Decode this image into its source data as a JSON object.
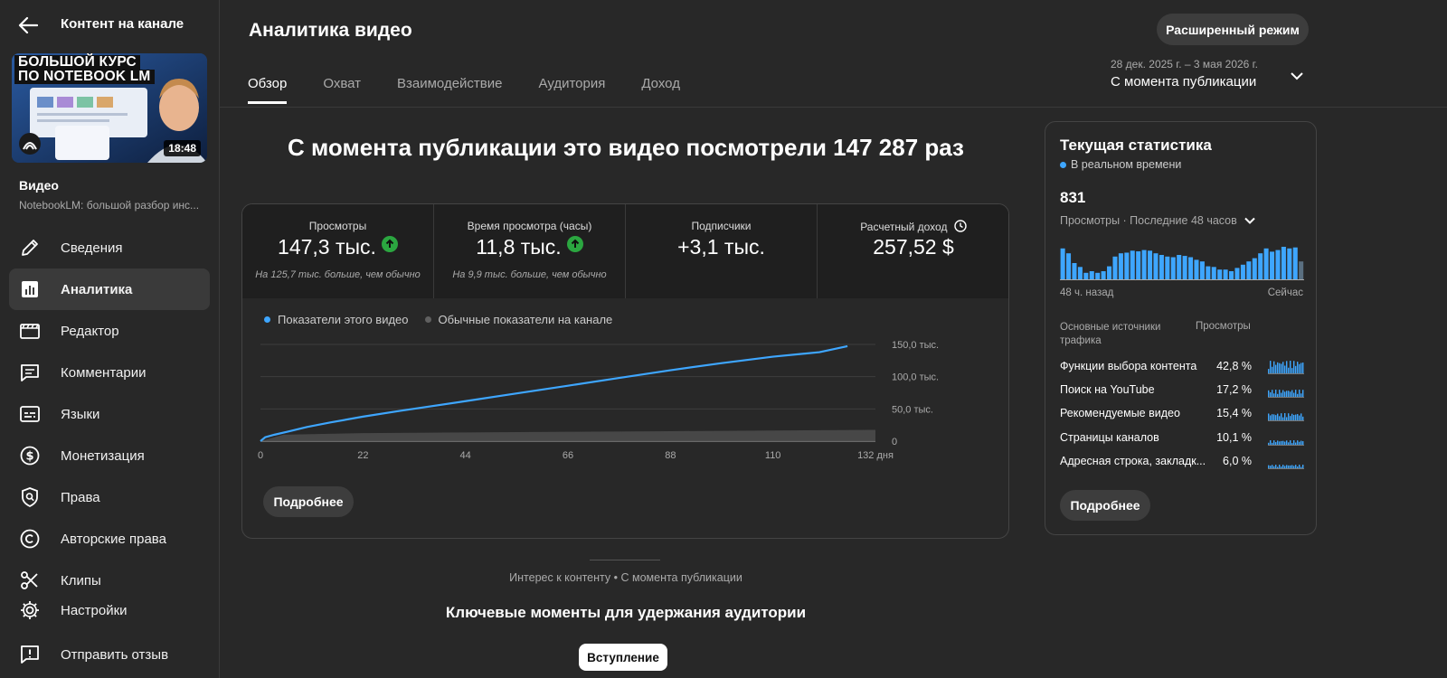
{
  "sidebar": {
    "title": "Контент на канале",
    "thumbnail": {
      "title_line1": "БОЛЬШОЙ КУРС",
      "title_line2": "ПО NOTEBOOK LM",
      "duration": "18:48"
    },
    "video_label": "Видео",
    "video_subtitle": "NotebookLM: большой разбор инс...",
    "items": [
      {
        "label": "Сведения",
        "icon": "pencil-icon"
      },
      {
        "label": "Аналитика",
        "icon": "analytics-icon",
        "active": true
      },
      {
        "label": "Редактор",
        "icon": "editor-icon"
      },
      {
        "label": "Комментарии",
        "icon": "comments-icon"
      },
      {
        "label": "Языки",
        "icon": "subtitles-icon"
      },
      {
        "label": "Монетизация",
        "icon": "dollar-icon"
      },
      {
        "label": "Права",
        "icon": "shield-search-icon"
      },
      {
        "label": "Авторские права",
        "icon": "copyright-icon"
      },
      {
        "label": "Клипы",
        "icon": "scissors-icon"
      },
      {
        "label": "Настройки",
        "icon": "gear-icon"
      },
      {
        "label": "Отправить отзыв",
        "icon": "feedback-icon"
      }
    ]
  },
  "header": {
    "title": "Аналитика видео",
    "advanced_button": "Расширенный режим",
    "tabs": [
      "Обзор",
      "Охват",
      "Взаимодействие",
      "Аудитория",
      "Доход"
    ],
    "date_range": "28 дек. 2025 г. – 3 мая 2026 г.",
    "date_mode": "С момента публикации"
  },
  "overview": {
    "headline": "С момента публикации это видео посмотрели 147 287 раз",
    "metrics": [
      {
        "title": "Просмотры",
        "value": "147,3 тыс.",
        "trend": "up",
        "note": "На 125,7 тыс. больше, чем обычно"
      },
      {
        "title": "Время просмотра (часы)",
        "value": "11,8 тыс.",
        "trend": "up",
        "note": "На 9,9 тыс. больше, чем обычно"
      },
      {
        "title": "Подписчики",
        "value": "+3,1 тыс.",
        "note": ""
      },
      {
        "title": "Расчетный доход",
        "value": "257,52 $",
        "note": ""
      }
    ],
    "legend": [
      "Показатели этого видео",
      "Обычные показатели на канале"
    ],
    "more_button": "Подробнее"
  },
  "chart_data": {
    "type": "line",
    "x_tick_labels": [
      "0",
      "22",
      "44",
      "66",
      "88",
      "110",
      "132 дня"
    ],
    "x_ticks": [
      0,
      22,
      44,
      66,
      88,
      110,
      132
    ],
    "y_tick_labels": [
      "0",
      "50,0 тыс.",
      "100,0 тыс.",
      "150,0 тыс."
    ],
    "ylim": [
      0,
      150000
    ],
    "xlim": [
      0,
      132
    ],
    "series": [
      {
        "name": "Показатели этого видео",
        "color": "#3ea6ff",
        "x": [
          0,
          1,
          3,
          6,
          10,
          15,
          22,
          30,
          44,
          55,
          66,
          77,
          88,
          99,
          110,
          120,
          126
        ],
        "y": [
          0,
          6000,
          10000,
          15000,
          22000,
          29000,
          38000,
          47000,
          62000,
          74000,
          86000,
          98000,
          110000,
          121000,
          131000,
          138000,
          147300
        ]
      },
      {
        "name": "Обычные показатели на канале",
        "color": "#606060",
        "x": [
          0,
          5,
          22,
          44,
          66,
          88,
          110,
          132
        ],
        "y": [
          0,
          10000,
          12500,
          13500,
          14500,
          15500,
          16500,
          17500
        ]
      }
    ]
  },
  "realtime": {
    "title": "Текущая статистика",
    "live_label": "В реальном времени",
    "count": "831",
    "subtitle": "Просмотры · Последние 48 часов",
    "bars": [
      95,
      80,
      50,
      38,
      20,
      25,
      20,
      25,
      40,
      70,
      80,
      82,
      88,
      86,
      90,
      88,
      80,
      75,
      70,
      68,
      75,
      72,
      68,
      60,
      55,
      40,
      38,
      30,
      30,
      25,
      35,
      45,
      55,
      65,
      80,
      95,
      85,
      90,
      100,
      95,
      98,
      55
    ],
    "bars_start_label": "48 ч. назад",
    "bars_end_label": "Сейчас",
    "sources_header": "Основные источники трафика",
    "views_header": "Просмотры",
    "sources": [
      {
        "name": "Функции выбора контента",
        "pct": "42,8 %"
      },
      {
        "name": "Поиск на YouTube",
        "pct": "17,2 %"
      },
      {
        "name": "Рекомендуемые видео",
        "pct": "15,4 %"
      },
      {
        "name": "Страницы каналов",
        "pct": "10,1 %"
      },
      {
        "name": "Адресная строка, закладк...",
        "pct": "6,0 %"
      }
    ],
    "more_button": "Подробнее"
  },
  "bottom": {
    "interest": "Интерес к контенту • С момента публикации",
    "key_moments": "Ключевые моменты для удержания аудитории",
    "intro_button": "Вступление"
  },
  "colors": {
    "accent": "#3ea6ff",
    "up": "#2ba640",
    "bg": "#282828"
  }
}
